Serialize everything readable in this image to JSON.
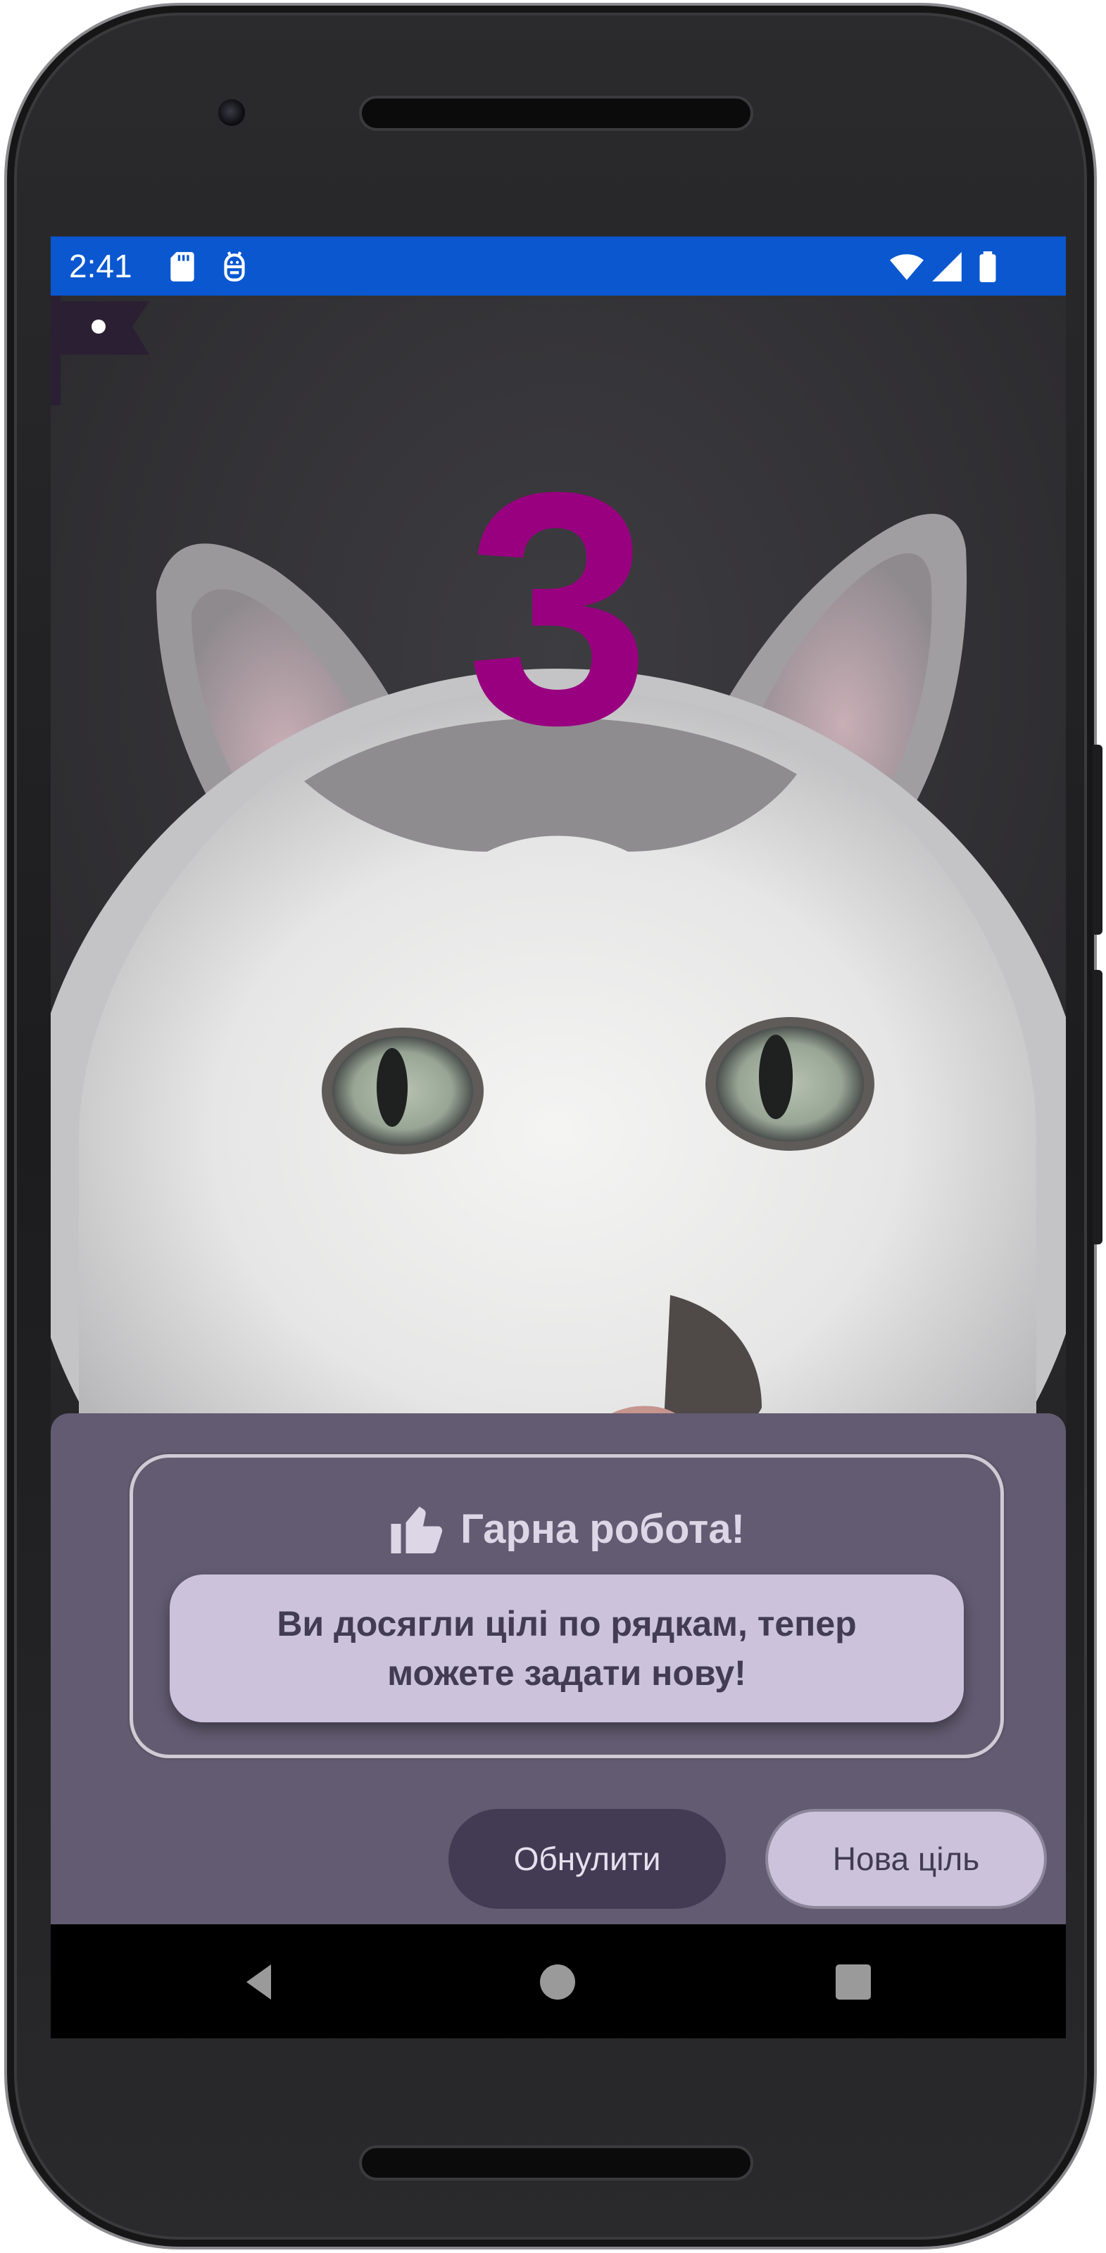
{
  "status_bar": {
    "time": "2:41",
    "background": "#0a57d0",
    "icons": [
      "sd-card-icon",
      "android-debug-icon",
      "wifi-icon",
      "cellular-signal-icon",
      "battery-icon"
    ]
  },
  "content": {
    "counter": "3",
    "counter_color": "#990080",
    "background_image": "cat-photo",
    "side_icon": "flag-icon"
  },
  "dialog": {
    "icon": "thumbs-up-icon",
    "title": "Гарна робота!",
    "message": "Ви досягли цілі по рядкам, тепер можете задати нову!",
    "buttons": {
      "reset": "Обнулити",
      "new_goal": "Нова ціль"
    },
    "sheet_color": "#625b71",
    "accent_light": "#ccc2dc",
    "accent_dark": "#433b54"
  },
  "navigation_bar": {
    "icons": [
      "back-icon",
      "home-icon",
      "recents-icon"
    ]
  }
}
